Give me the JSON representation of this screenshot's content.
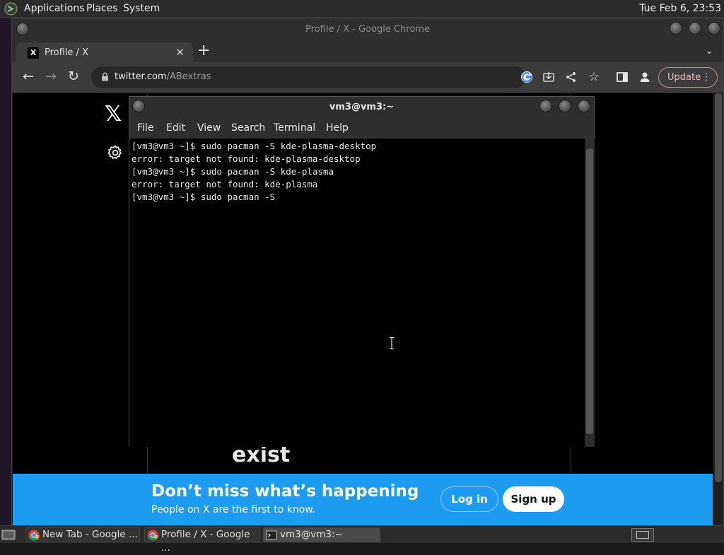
{
  "top_panel": {
    "menus": [
      "Applications",
      "Places",
      "System"
    ],
    "clock": "Tue Feb  6, 23:53"
  },
  "chrome": {
    "window_title": "Profile / X - Google Chrome",
    "tab": {
      "title": "Profile / X",
      "favicon": "X"
    },
    "omnibox": {
      "host": "twitter.com",
      "path": "/ABextras"
    },
    "update_label": "Update"
  },
  "page": {
    "logo": "𝕏",
    "heading_fragment": "exist",
    "banner": {
      "headline": "Don’t miss what’s happening",
      "subtext": "People on X are the first to know.",
      "login_label": "Log in",
      "signup_label": "Sign up"
    }
  },
  "terminal": {
    "title": "vm3@vm3:~",
    "menus": [
      "File",
      "Edit",
      "View",
      "Search",
      "Terminal",
      "Help"
    ],
    "lines": [
      "[vm3@vm3 ~]$ sudo pacman -S kde-plasma-desktop",
      "error: target not found: kde-plasma-desktop",
      "[vm3@vm3 ~]$ sudo pacman -S kde-plasma",
      "error: target not found: kde-plasma",
      "[vm3@vm3 ~]$ sudo pacman -S"
    ]
  },
  "taskbar": {
    "tasks": [
      "New Tab - Google ...",
      "Profile / X - Google ...",
      "vm3@vm3:~"
    ]
  },
  "colors": {
    "x_blue": "#1d9bf0",
    "terminal_bg": "#000000",
    "update_accent": "#f2b8b5"
  }
}
